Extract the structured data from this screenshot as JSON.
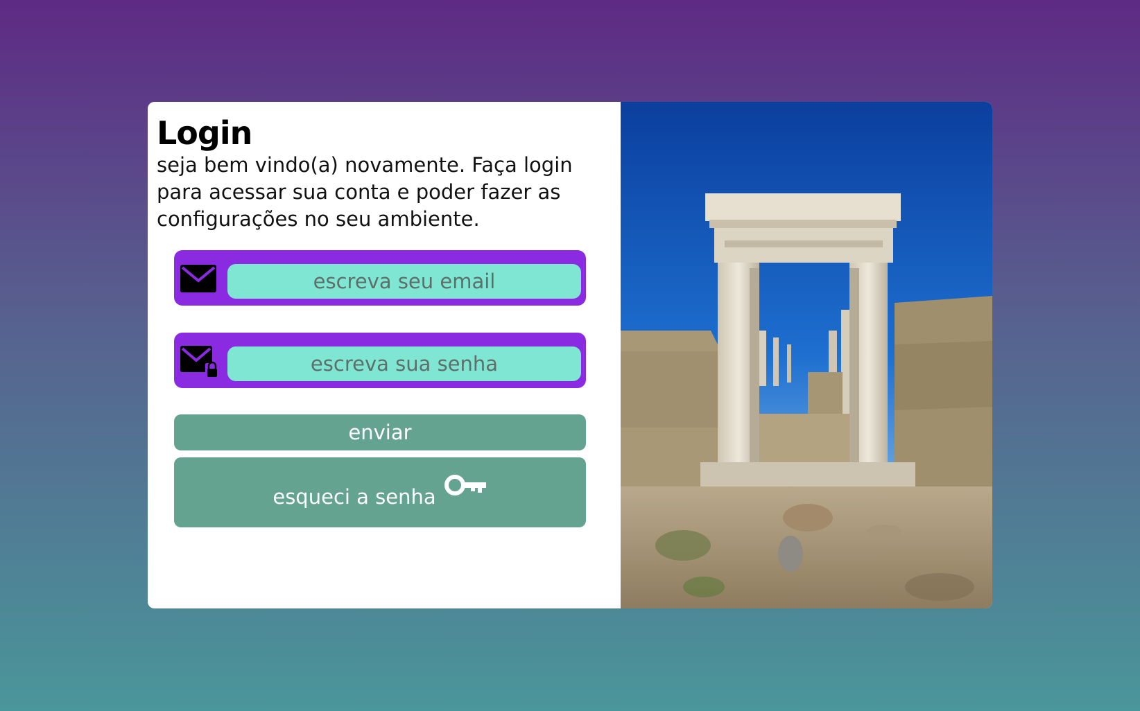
{
  "login": {
    "title": "Login",
    "subtitle": "seja bem vindo(a) novamente. Faça login para acessar sua conta e poder fazer as configurações no seu ambiente.",
    "email": {
      "placeholder": "escreva seu email",
      "icon": "envelope-icon"
    },
    "password": {
      "placeholder": "escreva sua senha",
      "icon": "envelope-lock-icon"
    },
    "send_label": "enviar",
    "forgot_label": "esqueci a senha",
    "forgot_icon": "key-icon"
  },
  "colors": {
    "background_top": "#5e2a84",
    "background_bottom": "#4a969a",
    "field_frame": "#8a2be2",
    "field_input": "#7fe6d4",
    "button": "#63a38f"
  }
}
